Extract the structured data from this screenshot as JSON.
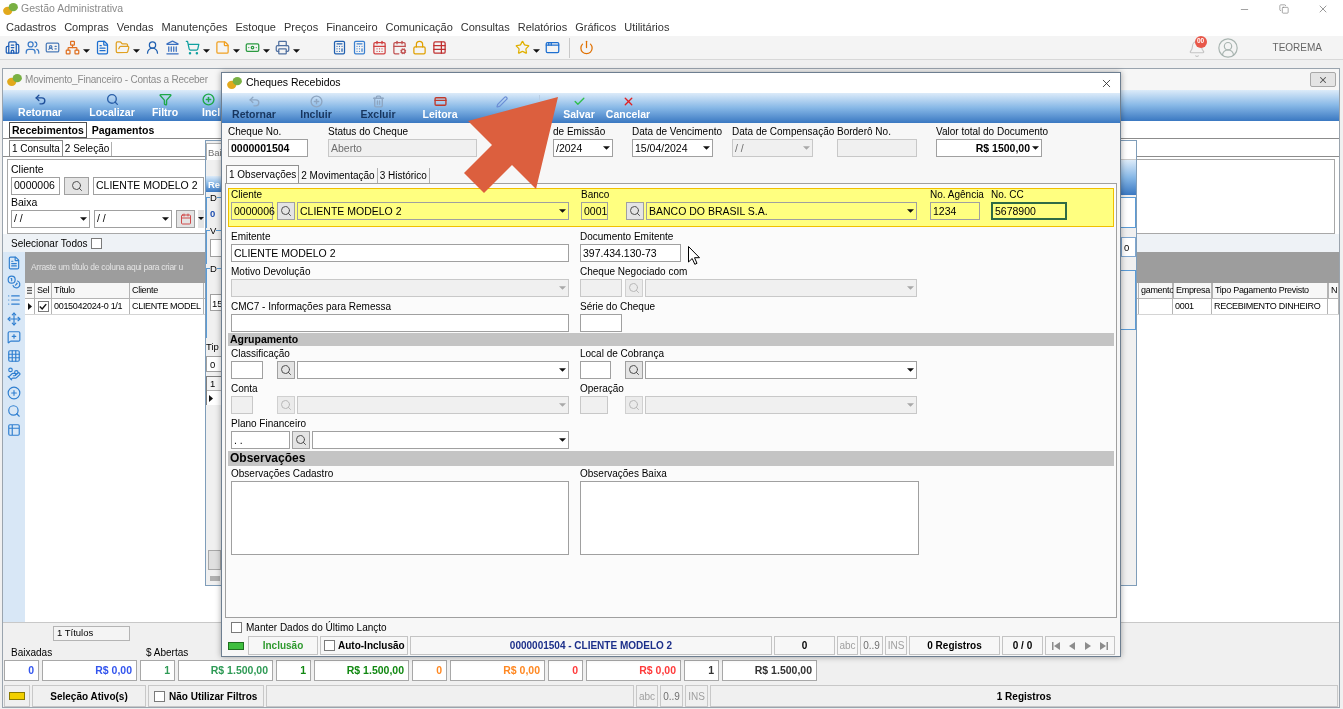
{
  "app": {
    "title": "Gestão Administrativa",
    "menu": [
      "Cadastros",
      "Compras",
      "Vendas",
      "Manutenções",
      "Estoque",
      "Preços",
      "Financeiro",
      "Comunicação",
      "Consultas",
      "Relatórios",
      "Gráficos",
      "Utilitários"
    ],
    "notification_count": "00",
    "user": "TEOREMA"
  },
  "contas_window": {
    "title": "Movimento_Financeiro - Contas a Receber",
    "toolbar": [
      "Retornar",
      "Localizar",
      "Filtro",
      "Incl"
    ],
    "tabs": [
      {
        "label": "Recebimentos",
        "selected": true
      },
      {
        "label": "Pagamentos",
        "selected": false
      }
    ],
    "subtabs": [
      {
        "label": "1 Consulta",
        "selected": true
      },
      {
        "label": "2 Seleção",
        "selected": false
      }
    ],
    "filters": {
      "cliente_label": "Cliente",
      "cliente_code": "0000006",
      "cliente_name": "CLIENTE MODELO 2",
      "baixa_label": "Baixa",
      "baixa_from": "/ /",
      "baixa_to": "/ /"
    },
    "select_all": {
      "label": "Selecionar Todos",
      "checked": false
    },
    "group_hint": "Arraste um título de coluna aqui para criar u",
    "table": {
      "columns": [
        "Sel",
        "Título",
        "Cliente",
        "gamento",
        "Empresa",
        "Tipo Pagamento Previsto",
        "N"
      ],
      "rows": [
        {
          "selected": true,
          "checked": true,
          "titulo": "0015042024-0 1/1",
          "cliente": "CLIENTE MODEL",
          "empresa": "0001",
          "tipo_pagamento": "RECEBIMENTO DINHEIRO"
        }
      ]
    },
    "footer_count": "1 Títulos",
    "totals": {
      "labels": [
        "Baixadas",
        "$ Abertas"
      ],
      "cells": [
        {
          "value": "0",
          "color": "#3355ee"
        },
        {
          "value": "R$ 0,00",
          "color": "#3355ee"
        },
        {
          "value": "1",
          "color": "#2e9a55"
        },
        {
          "value": "R$ 1.500,00",
          "color": "#2e9a55"
        },
        {
          "value": "1",
          "color": "#118811"
        },
        {
          "value": "R$ 1.500,00",
          "color": "#118811"
        },
        {
          "value": "0",
          "color": "#ff8822"
        },
        {
          "value": "R$ 0,00",
          "color": "#ff8822"
        },
        {
          "value": "0",
          "color": "#ff3b3b"
        },
        {
          "value": "R$ 0,00",
          "color": "#ff3b3b"
        },
        {
          "value": "1",
          "color": "#333333"
        },
        {
          "value": "R$ 1.500,00",
          "color": "#333333"
        }
      ]
    },
    "status_bar": {
      "selection": "Seleção Ativo(s)",
      "no_filters": {
        "label": "Não Utilizar Filtros",
        "checked": false
      },
      "abc": "abc",
      "digits": "0..9",
      "ins": "INS",
      "records": "1 Registros"
    }
  },
  "middle_window": {
    "tab": "Bai",
    "header": "Re",
    "group_1": {
      "title": "D",
      "value": "0"
    },
    "group_2": {
      "title": "V"
    },
    "group_3": {
      "title": "D",
      "value": "15"
    },
    "field_label": "Tip",
    "field_value": "0",
    "grid_header": "1",
    "right_value": "0"
  },
  "cheque_dialog": {
    "title": "Cheques Recebidos",
    "toolbar": [
      {
        "label": "Retornar",
        "disabled": true
      },
      {
        "label": "Incluir",
        "disabled": true
      },
      {
        "label": "Excluir",
        "disabled": true
      },
      {
        "label": "Leitora",
        "disabled": false
      },
      {
        "label": "Salvar",
        "disabled": false
      },
      {
        "label": "Cancelar",
        "disabled": false
      }
    ],
    "header": [
      {
        "kind": "text",
        "label": "Cheque No.",
        "value": "0000001504",
        "bold": true,
        "disabled": false
      },
      {
        "kind": "text",
        "label": "Status do Cheque",
        "value": "Aberto",
        "bold": false,
        "disabled": true
      },
      {
        "kind": "combo",
        "label": "de Emissão",
        "value": "/2024",
        "bold": false,
        "disabled": false
      },
      {
        "kind": "combo",
        "label": "Data de Vencimento",
        "value": "15/04/2024",
        "bold": false,
        "disabled": false
      },
      {
        "kind": "combo",
        "label": "Data de Compensação",
        "value": "/ /",
        "bold": false,
        "disabled": true
      },
      {
        "kind": "text",
        "label": "Borderô No.",
        "bold": false,
        "disabled": true
      },
      {
        "kind": "combo",
        "label": "Valor total do Documento",
        "value": "R$ 1500,00",
        "bold": true,
        "disabled": false
      }
    ],
    "tabs": [
      {
        "label": "1 Observações",
        "selected": true
      },
      {
        "label": "2 Movimentação",
        "selected": false
      },
      {
        "label": "3 Histórico",
        "selected": false
      }
    ],
    "highlight_row": [
      {
        "kind": "lookup",
        "label": "Cliente",
        "code": "0000006",
        "name": "CLIENTE MODELO 2",
        "disabled": false,
        "focused": false
      },
      {
        "kind": "lookup",
        "label": "Banco",
        "code": "0001",
        "name": "BANCO DO BRASIL S.A.",
        "disabled": false,
        "focused": false
      },
      {
        "kind": "text",
        "label": "No. Agência",
        "value": "1234",
        "disabled": false,
        "focused": false
      },
      {
        "kind": "text",
        "label": "No. CC",
        "value": "5678900",
        "disabled": false,
        "focused": true
      }
    ],
    "form": [
      {
        "kind": "row",
        "fields": [
          {
            "kind": "text",
            "label": "Emitente",
            "value": "CLIENTE MODELO 2",
            "disabled": false
          },
          {
            "kind": "text",
            "label": "Documento Emitente",
            "value": "397.434.130-73",
            "disabled": false
          }
        ]
      },
      {
        "kind": "row",
        "fields": [
          {
            "kind": "combo",
            "label": "Motivo Devolução",
            "disabled": true
          },
          {
            "kind": "lookup",
            "label": "Cheque Negociado com",
            "disabled": true
          }
        ]
      },
      {
        "kind": "row",
        "fields": [
          {
            "kind": "text",
            "label": "CMC7 - Informações para Remessa",
            "disabled": false
          },
          {
            "kind": "text",
            "label": "Série do Cheque",
            "disabled": false
          }
        ]
      },
      {
        "kind": "subsection",
        "title": "Agrupamento"
      },
      {
        "kind": "row",
        "fields": [
          {
            "kind": "lookup",
            "label": "Classificação",
            "disabled": false
          },
          {
            "kind": "lookup",
            "label": "Local de Cobrança",
            "disabled": false
          }
        ]
      },
      {
        "kind": "row",
        "fields": [
          {
            "kind": "lookup",
            "label": "Conta",
            "disabled": true
          },
          {
            "kind": "lookup",
            "label": "Operação",
            "disabled": true
          }
        ]
      },
      {
        "kind": "row",
        "fields": [
          {
            "kind": "lookup",
            "label": "Plano Financeiro",
            "code": ". .",
            "disabled": false
          }
        ]
      },
      {
        "kind": "section",
        "title": "Observações"
      },
      {
        "kind": "row",
        "fields": [
          {
            "kind": "textarea",
            "label": "Observações Cadastro",
            "disabled": false
          },
          {
            "kind": "textarea",
            "label": "Observações Baixa",
            "disabled": false
          }
        ]
      }
    ],
    "keep_data": {
      "label": "Manter Dados do Último Lançto",
      "checked": false
    },
    "status_bar": {
      "mode": "Inclusão",
      "auto_inclusion": {
        "label": "Auto-Inclusão",
        "checked": false
      },
      "record": "0000001504 - CLIENTE MODELO 2",
      "count": "0",
      "abc": "abc",
      "digits": "0..9",
      "ins": "INS",
      "records": "0 Registros",
      "position": "0 / 0"
    }
  }
}
